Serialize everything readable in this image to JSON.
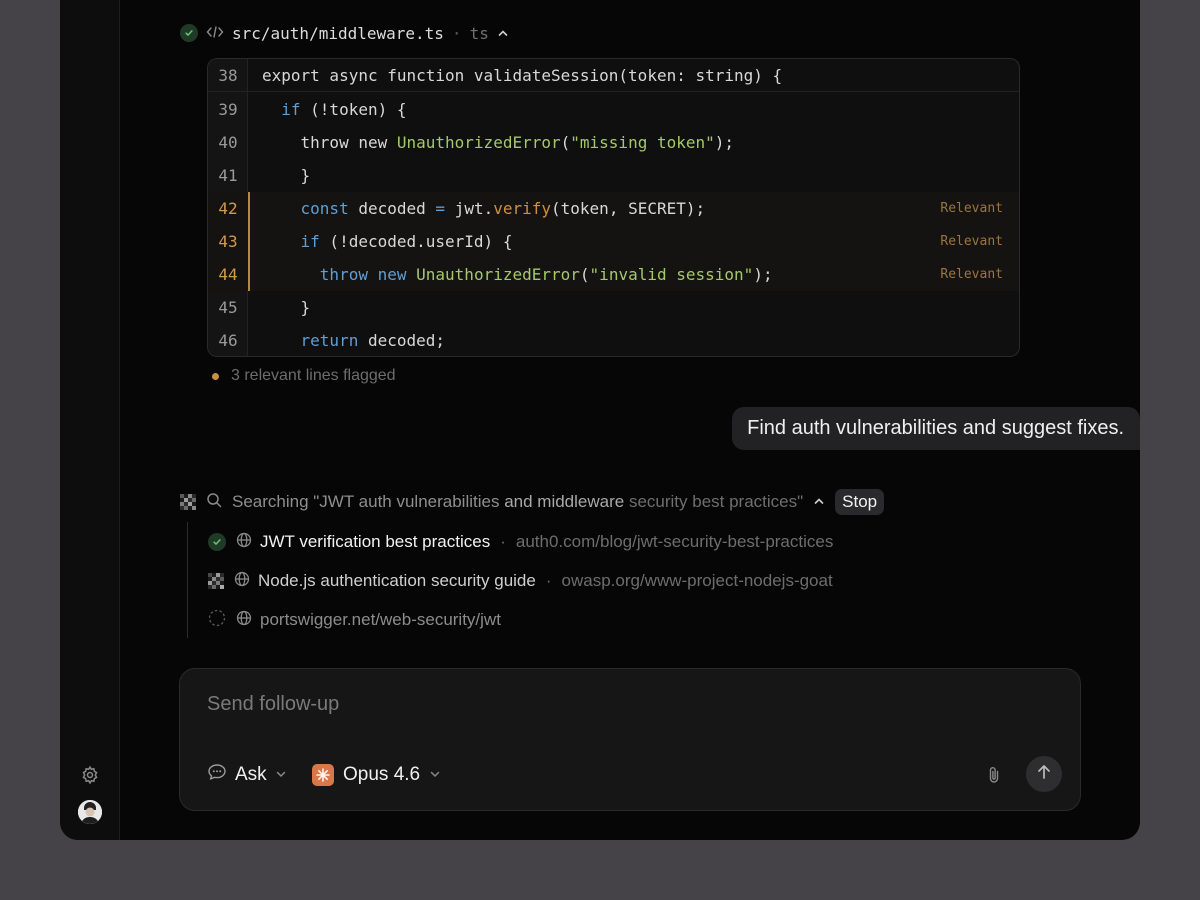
{
  "file": {
    "path": "src/auth/middleware.ts",
    "separator": "·",
    "language": "ts"
  },
  "code": {
    "line_numbers": [
      "38",
      "39",
      "40",
      "41",
      "42",
      "43",
      "44",
      "45",
      "46"
    ],
    "relevant_label": "Relevant",
    "relevant_lines": [
      "42",
      "43",
      "44"
    ]
  },
  "flag_text": "3 relevant lines flagged",
  "user_message": "Find auth vulnerabilities and suggest fixes.",
  "search": {
    "prefix": "Searching \"JWT auth vulnerabilities",
    "middle": " and middleware",
    "suffix": " security best practices\"",
    "stop_label": "Stop",
    "results": [
      {
        "title": "JWT verification best practices",
        "separator": "·",
        "url": "auth0.com/blog/jwt-security-best-practices",
        "status": "done"
      },
      {
        "title": "Node.js authentication security guide",
        "separator": "·",
        "url": "owasp.org/www-project-nodejs-goat",
        "status": "loading"
      },
      {
        "title": "portswigger.net/web-security/jwt",
        "status": "pending"
      }
    ]
  },
  "composer": {
    "placeholder": "Send follow-up",
    "mode_label": "Ask",
    "model_label": "Opus 4.6"
  },
  "colors": {
    "accent_relevant": "#c98f45",
    "success": "#3f8f4f",
    "model_icon": "#d9774a"
  },
  "icons": [
    "check-icon",
    "code-icon",
    "chevron-up-icon",
    "search-icon",
    "globe-icon",
    "spinner-icon",
    "chat-icon",
    "chevron-down-icon",
    "paperclip-icon",
    "arrow-up-icon",
    "gear-icon",
    "avatar"
  ]
}
